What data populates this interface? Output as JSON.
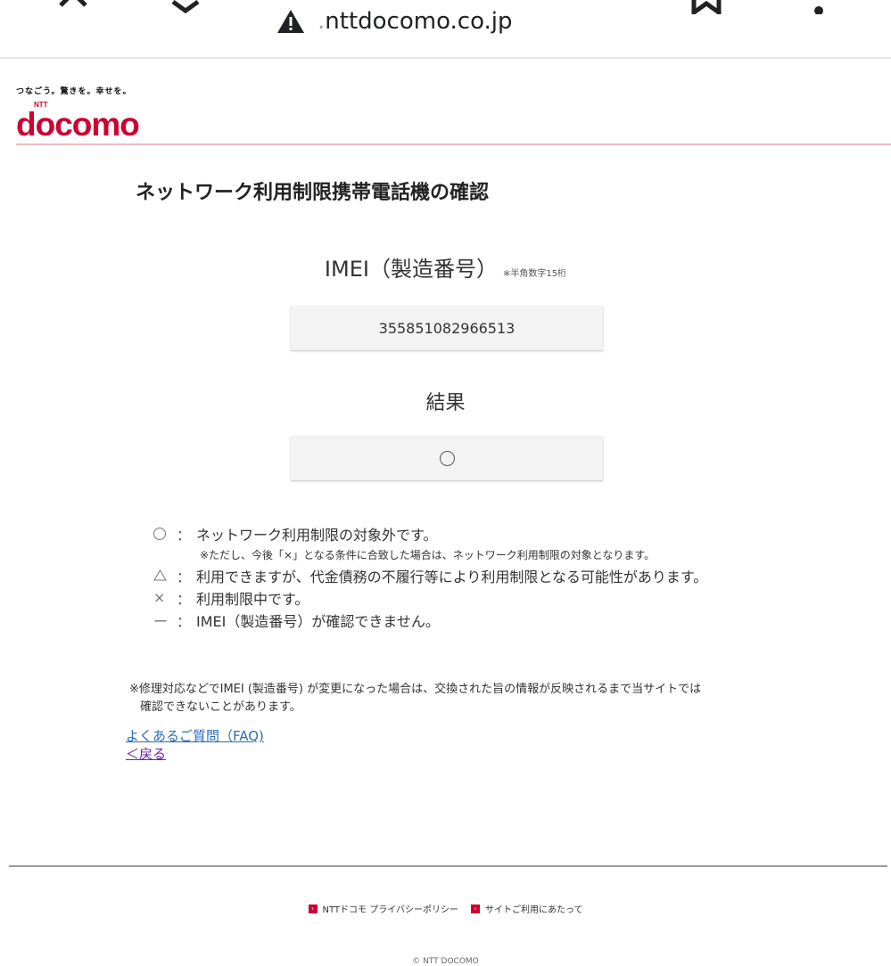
{
  "browser": {
    "url_prefix": ".",
    "url_domain": "nttdocomo.co.jp",
    "close_icon": "close-icon",
    "warning_icon": "warning-icon",
    "share_icon": "share-icon",
    "bookmark_icon": "bookmark-icon",
    "menu_icon": "more-vert-icon"
  },
  "header": {
    "tagline": "つなごう。驚きを。幸せを。",
    "logo_text": "docomo",
    "logo_small": "NTT",
    "accent_color": "#cc0033"
  },
  "main": {
    "title": "ネットワーク利用制限携帯電話機の確認",
    "imei_label": "IMEI（製造番号）",
    "imei_note": "※半角数字15桁",
    "imei_value": "355851082966513",
    "result_label": "結果",
    "result_value": "○"
  },
  "legend": {
    "items": [
      {
        "symbol": "○",
        "colon": "：",
        "text": "ネットワーク利用制限の対象外です。"
      },
      {
        "sub": "※ただし、今後「×」となる条件に合致した場合は、ネットワーク利用制限の対象となります。"
      },
      {
        "symbol": "△",
        "colon": "：",
        "text": "利用できますが、代金債務の不履行等により利用制限となる可能性があります。"
      },
      {
        "symbol": "×",
        "colon": "：",
        "text": "利用制限中です。"
      },
      {
        "symbol": "ー",
        "colon": "：",
        "text": "IMEI（製造番号）が確認できません。"
      }
    ]
  },
  "notes": {
    "line1": "※修理対応などでIMEI (製造番号) が変更になった場合は、交換された旨の情報が反映されるまで当サイトでは",
    "line2": "確認できないことがあります。"
  },
  "links": {
    "faq": "よくあるご質問（FAQ)",
    "back": "＜戻る"
  },
  "footer": {
    "privacy": "NTTドコモ プライバシーポリシー",
    "terms": "サイトご利用にあたって",
    "copyright": "© NTT DOCOMO"
  }
}
